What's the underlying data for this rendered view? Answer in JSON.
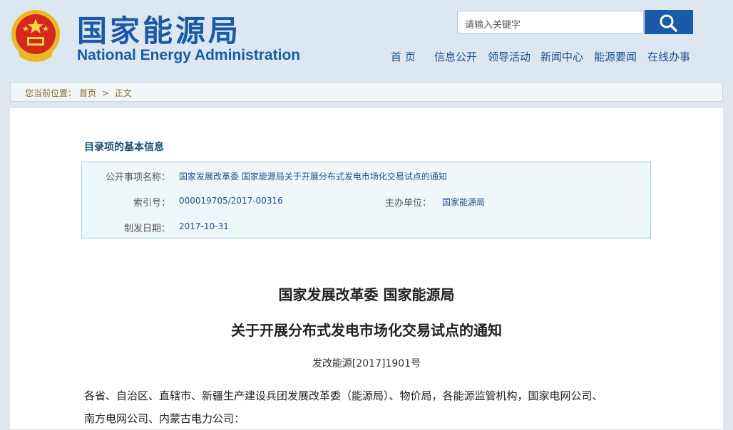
{
  "header": {
    "title_cn": "国家能源局",
    "title_en": "National Energy Administration",
    "search_placeholder": "请输入关键字",
    "nav": [
      "首 页",
      "信息公开",
      "领导活动",
      "新闻中心",
      "能源要闻",
      "在线办事"
    ]
  },
  "breadcrumb": {
    "prefix": "您当前位置：",
    "items": [
      "首页",
      "正文"
    ],
    "separator": ">"
  },
  "info": {
    "heading": "目录项的基本信息",
    "rows": {
      "title_label": "公开事项名称：",
      "title_value": "国家发展改革委 国家能源局关于开展分布式发电市场化交易试点的通知",
      "index_label": "索引号：",
      "index_value": "000019705/2017-00316",
      "dept_label": "主办单位：",
      "dept_value": "国家能源局",
      "date_label": "制发日期：",
      "date_value": "2017-10-31"
    }
  },
  "document": {
    "title_line1": "国家发展改革委 国家能源局",
    "title_line2": "关于开展分布式发电市场化交易试点的通知",
    "doc_number": "发改能源[2017]1901号",
    "body_line1": "各省、自治区、直辖市、新疆生产建设兵团发展改革委（能源局）、物价局，各能源监管机构，国家电网公司、",
    "body_line2": "南方电网公司、内蒙古电力公司："
  },
  "colors": {
    "brand_blue": "#1b5aa6",
    "header_bg": "#dce7f2",
    "emblem_red": "#d7261e",
    "emblem_gold": "#e8b923"
  },
  "icons": [
    "national-emblem-icon",
    "search-icon"
  ]
}
